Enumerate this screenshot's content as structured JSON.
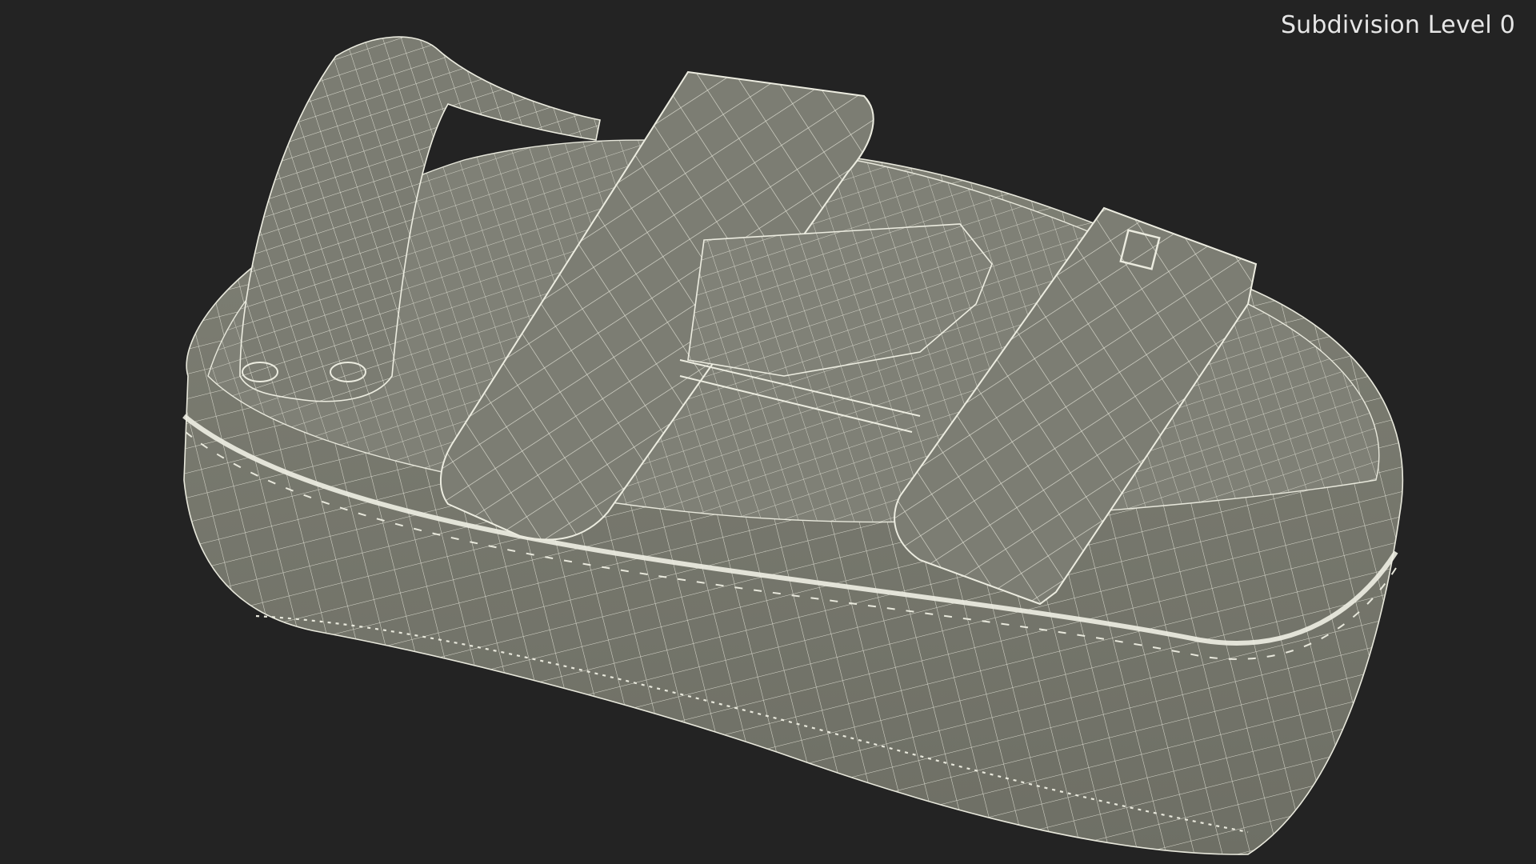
{
  "viewport": {
    "overlay_label": "Subdivision Level 0",
    "background_color": "#232323",
    "mesh_fill_color": "#7a7b70",
    "wire_color": "#e8e8dc"
  }
}
